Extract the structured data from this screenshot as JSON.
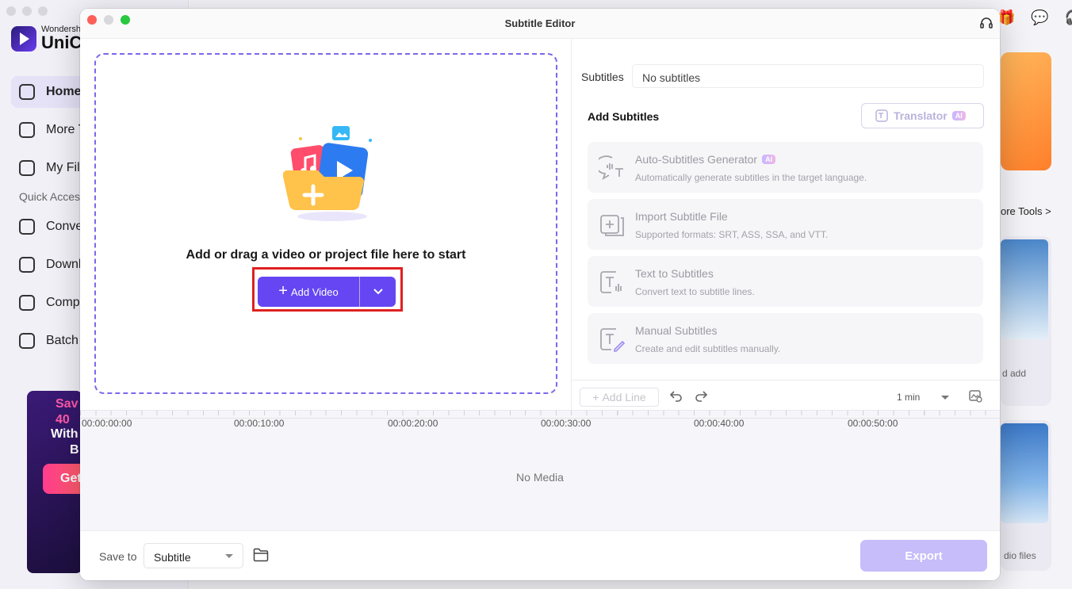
{
  "background_app": {
    "logo_small": "Wondersh",
    "logo_big": "UniCo",
    "nav": [
      {
        "label": "Home",
        "active": true
      },
      {
        "label": "More T",
        "active": false
      },
      {
        "label": "My Fil",
        "active": false
      }
    ],
    "quick_access": "Quick Acces",
    "quick_items": [
      "Conve",
      "Downl",
      "Comp",
      "Batch"
    ],
    "promo": {
      "line1": "Sav",
      "line2": "40",
      "line3": "With",
      "line4": "B",
      "button": "Get"
    },
    "more_tools": "ore Tools >",
    "card1_text": "d add",
    "card2_text": "dio files"
  },
  "dialog": {
    "title": "Subtitle Editor",
    "drop_text": "Add or drag a video or project file here to start",
    "add_video_label": "Add Video",
    "subtitles_label": "Subtitles",
    "subtitles_value": "No subtitles",
    "add_subtitles_title": "Add Subtitles",
    "translator_label": "Translator",
    "ai_badge": "AI",
    "options": [
      {
        "title": "Auto-Subtitles Generator",
        "desc": "Automatically generate subtitles in the target language.",
        "ai": true,
        "icon": "auto-subtitle-icon"
      },
      {
        "title": "Import Subtitle File",
        "desc": "Supported formats: SRT, ASS, SSA, and VTT.",
        "ai": false,
        "icon": "import-file-icon"
      },
      {
        "title": "Text to Subtitles",
        "desc": "Convert text to subtitle lines.",
        "ai": false,
        "icon": "text-to-subtitle-icon"
      },
      {
        "title": "Manual Subtitles",
        "desc": "Create and edit subtitles manually.",
        "ai": false,
        "icon": "manual-edit-icon"
      }
    ],
    "add_line_label": "Add Line",
    "zoom_value": "1 min",
    "timeline_ticks": [
      "00:00:00:00",
      "00:00:10:00",
      "00:00:20:00",
      "00:00:30:00",
      "00:00:40:00",
      "00:00:50:00"
    ],
    "no_media": "No Media",
    "save_to_label": "Save to",
    "save_to_value": "Subtitle",
    "export_label": "Export"
  },
  "colors": {
    "accent": "#6546f2",
    "highlight": "#e02020",
    "export_disabled": "#c6bdfa"
  }
}
